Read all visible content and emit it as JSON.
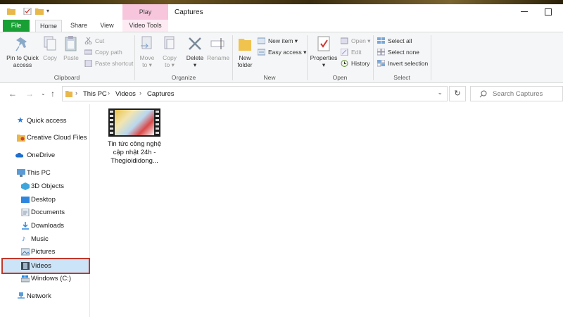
{
  "window": {
    "title": "Captures",
    "contextual_tab": "Play"
  },
  "tabs": [
    {
      "label": "File"
    },
    {
      "label": "Home"
    },
    {
      "label": "Share"
    },
    {
      "label": "View"
    },
    {
      "label": "Video Tools"
    }
  ],
  "ribbon": {
    "clipboard": {
      "label": "Clipboard",
      "pin_line1": "Pin to Quick",
      "pin_line2": "access",
      "copy": "Copy",
      "paste": "Paste",
      "cut": "Cut",
      "copy_path": "Copy path",
      "paste_shortcut": "Paste shortcut"
    },
    "organize": {
      "label": "Organize",
      "move_line1": "Move",
      "move_line2": "to",
      "copy_line1": "Copy",
      "copy_line2": "to",
      "delete": "Delete",
      "rename": "Rename"
    },
    "new": {
      "label": "New",
      "folder_line1": "New",
      "folder_line2": "folder",
      "new_item": "New item",
      "easy_access": "Easy access"
    },
    "open": {
      "label": "Open",
      "properties": "Properties",
      "open": "Open",
      "edit": "Edit",
      "history": "History"
    },
    "select": {
      "label": "Select",
      "select_all": "Select all",
      "select_none": "Select none",
      "invert_selection": "Invert selection"
    }
  },
  "address": {
    "crumbs": [
      "This PC",
      "Videos",
      "Captures"
    ],
    "search_placeholder": "Search Captures"
  },
  "navpane": {
    "quick_access": "Quick access",
    "creative_cloud": "Creative Cloud Files",
    "onedrive": "OneDrive",
    "this_pc": "This PC",
    "objects3d": "3D Objects",
    "desktop": "Desktop",
    "documents": "Documents",
    "downloads": "Downloads",
    "music": "Music",
    "pictures": "Pictures",
    "videos": "Videos",
    "windows_c": "Windows (C:)",
    "network": "Network"
  },
  "files": [
    {
      "name": "Tin tức công nghệ cập nhật 24h - Thegioididong..."
    }
  ],
  "colors": {
    "file_tab": "#19a035",
    "play_tab": "#f7c6dc",
    "selection": "#cce4f7",
    "highlight_border": "#c0392b"
  }
}
